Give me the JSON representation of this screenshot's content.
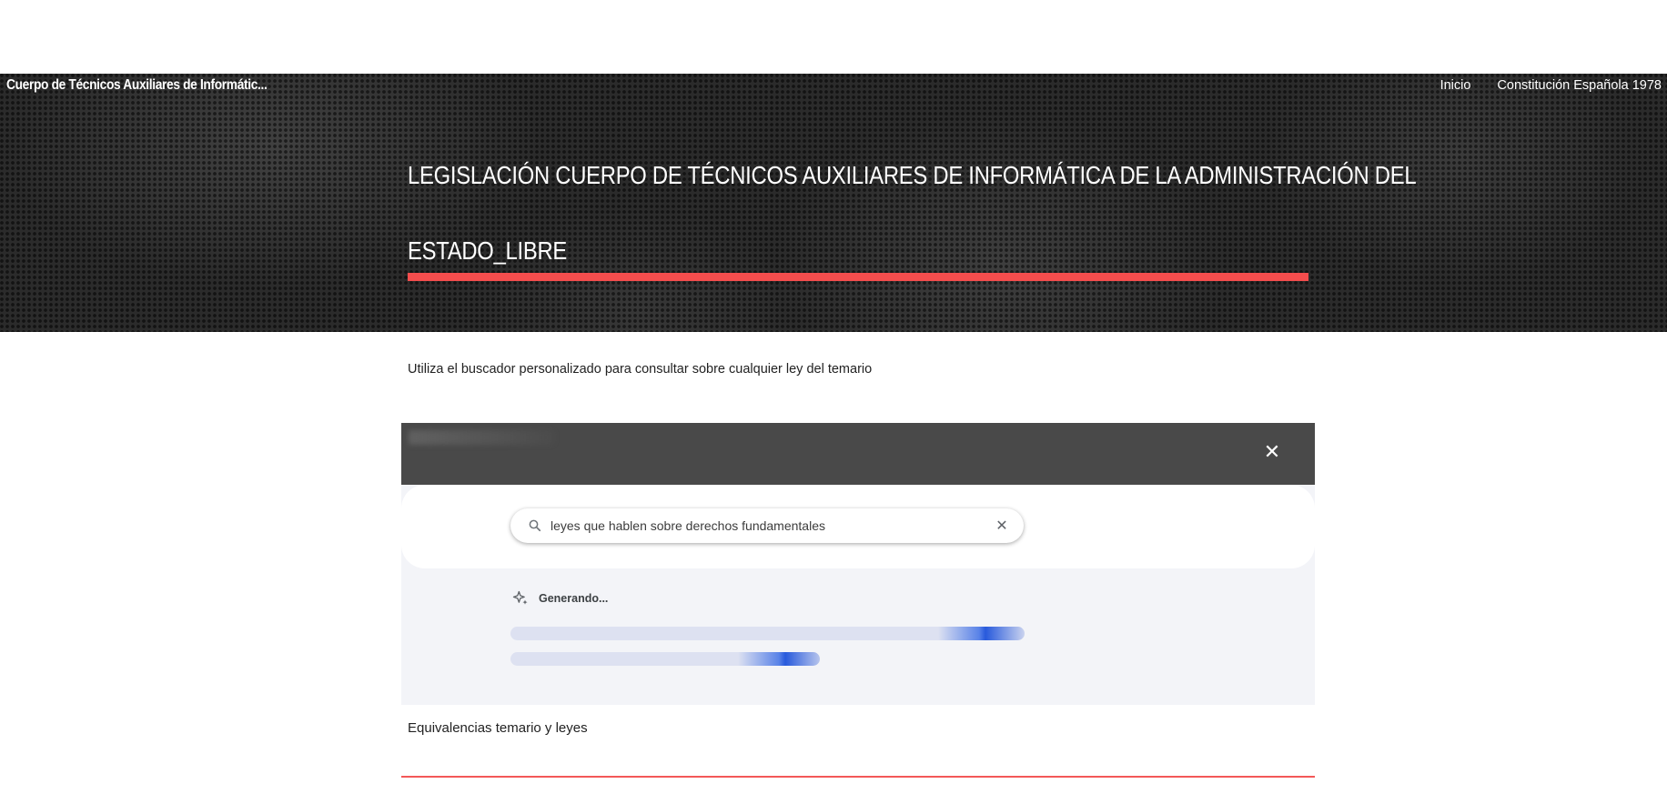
{
  "header": {
    "site_title": "Cuerpo de Técnicos Auxiliares de Informátic...",
    "nav": [
      {
        "label": "Inicio"
      },
      {
        "label": "Constitución Española 1978"
      }
    ]
  },
  "hero": {
    "title_line1": "LEGISLACIÓN CUERPO DE TÉCNICOS AUXILIARES DE INFORMÁTICA DE LA ADMINISTRACIÓN DEL",
    "title_line2": "ESTADO_LIBRE",
    "accent_color": "#f44d4d"
  },
  "intro": {
    "text": "Utiliza el buscador personalizado para consultar sobre cualquier ley del temario"
  },
  "search_widget": {
    "query": "leyes que hablen sobre derechos fundamentales",
    "status_label": "Generando...",
    "icons": {
      "close": "close-icon",
      "search": "search-icon",
      "clear": "clear-icon",
      "sparkle": "sparkle-icon"
    }
  },
  "footer_section": {
    "heading": "Equivalencias temario y leyes"
  }
}
